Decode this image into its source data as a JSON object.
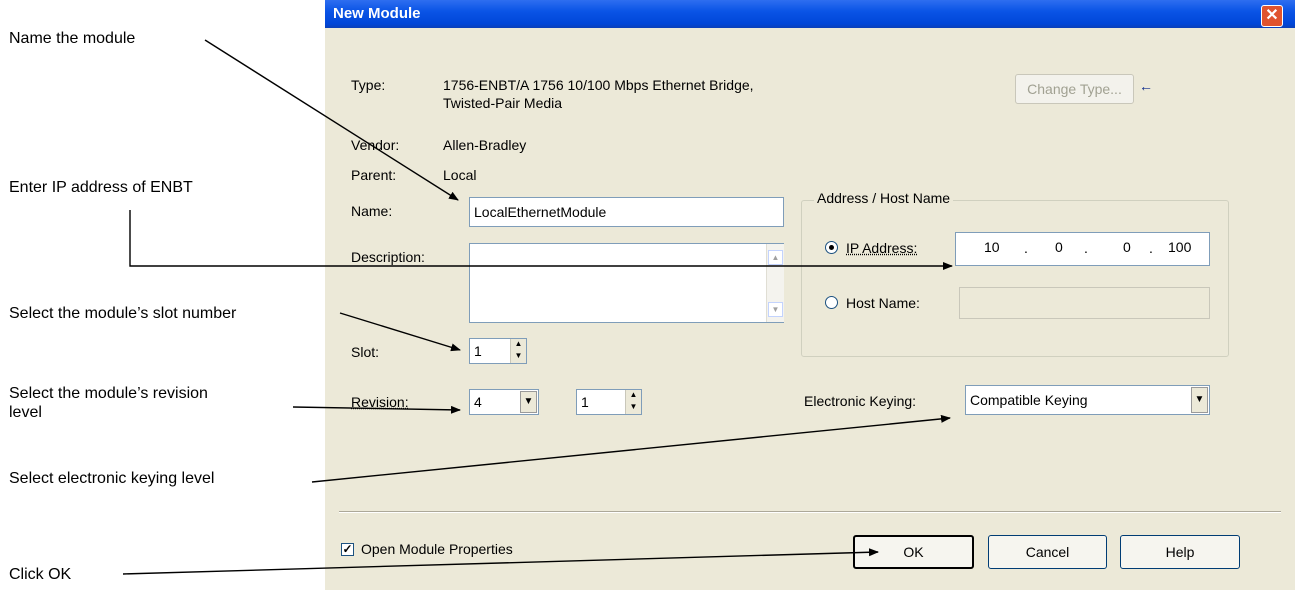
{
  "annotations": {
    "name_module": "Name the module",
    "enter_ip": "Enter IP address of ENBT",
    "select_slot": "Select the module’s slot number",
    "select_revision_line1": "Select the module’s revision",
    "select_revision_line2": "level",
    "select_keying": "Select electronic keying level",
    "click_ok": "Click OK"
  },
  "dialog": {
    "title": "New Module",
    "close_glyph": "✕",
    "type_label": "Type:",
    "type_value_line1": "1756-ENBT/A 1756 10/100 Mbps Ethernet Bridge,",
    "type_value_line2": "Twisted-Pair Media",
    "change_type_button": "Change Type...",
    "change_type_arrow": "←",
    "vendor_label": "Vendor:",
    "vendor_value": "Allen-Bradley",
    "parent_label": "Parent:",
    "parent_value": "Local",
    "name_label": "Name:",
    "name_value": "LocalEthernetModule",
    "description_label": "Description:",
    "description_value": "",
    "slot_label": "Slot:",
    "slot_value": "1",
    "revision_label": "Revision:",
    "revision_major": "4",
    "revision_minor": "1",
    "address_group_title": "Address / Host Name",
    "ip_radio_label": "IP Address:",
    "ip_octets": [
      "10",
      "0",
      "0",
      "100"
    ],
    "ip_dot": ".",
    "host_radio_label": "Host Name:",
    "host_value": "",
    "keying_label": "Electronic Keying:",
    "keying_value": "Compatible Keying",
    "open_props_label": "Open Module Properties",
    "open_props_checked": true,
    "check_glyph": "✓",
    "ok_button": "OK",
    "cancel_button": "Cancel",
    "help_button": "Help",
    "spin_up": "▲",
    "spin_down": "▼",
    "dropdown_glyph": "▼"
  },
  "colors": {
    "titlebar": "#0a54e6",
    "dialog_bg": "#ece9d8",
    "close": "#e0532e"
  },
  "icons": [
    "close-icon",
    "left-arrow-icon",
    "checkbox-check-icon",
    "dropdown-arrow-icon",
    "spin-up-icon",
    "spin-down-icon",
    "radio-dot-icon"
  ]
}
